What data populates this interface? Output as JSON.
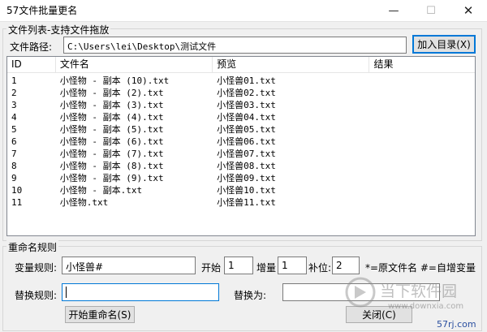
{
  "window": {
    "title": "57文件批量更名",
    "minimize_glyph": "—",
    "maximize_glyph": "☐",
    "close_glyph": "✕"
  },
  "file_list_group": {
    "title": "文件列表-支持文件拖放",
    "path_label": "文件路径:",
    "path_value": "C:\\Users\\lei\\Desktop\\测试文件",
    "add_dir_button": "加入目录(X)"
  },
  "table": {
    "columns": [
      "ID",
      "文件名",
      "预览",
      "结果"
    ],
    "rows": [
      {
        "id": "1",
        "name": "小怪物 - 副本 (10).txt",
        "preview": "小怪兽01.txt",
        "result": ""
      },
      {
        "id": "2",
        "name": "小怪物 - 副本 (2).txt",
        "preview": "小怪兽02.txt",
        "result": ""
      },
      {
        "id": "3",
        "name": "小怪物 - 副本 (3).txt",
        "preview": "小怪兽03.txt",
        "result": ""
      },
      {
        "id": "4",
        "name": "小怪物 - 副本 (4).txt",
        "preview": "小怪兽04.txt",
        "result": ""
      },
      {
        "id": "5",
        "name": "小怪物 - 副本 (5).txt",
        "preview": "小怪兽05.txt",
        "result": ""
      },
      {
        "id": "6",
        "name": "小怪物 - 副本 (6).txt",
        "preview": "小怪兽06.txt",
        "result": ""
      },
      {
        "id": "7",
        "name": "小怪物 - 副本 (7).txt",
        "preview": "小怪兽07.txt",
        "result": ""
      },
      {
        "id": "8",
        "name": "小怪物 - 副本 (8).txt",
        "preview": "小怪兽08.txt",
        "result": ""
      },
      {
        "id": "9",
        "name": "小怪物 - 副本 (9).txt",
        "preview": "小怪兽09.txt",
        "result": ""
      },
      {
        "id": "10",
        "name": "小怪物 - 副本.txt",
        "preview": "小怪兽10.txt",
        "result": ""
      },
      {
        "id": "11",
        "name": "小怪物.txt",
        "preview": "小怪兽11.txt",
        "result": ""
      }
    ]
  },
  "rename_group": {
    "title": "重命名规则",
    "rule_label": "变量规则:",
    "rule_value": "小怪兽#",
    "start_label": "开始",
    "start_value": "1",
    "step_label": "增量",
    "step_value": "1",
    "pad_label": "补位:",
    "pad_value": "2",
    "hint": "*=原文件名 #=自增变量",
    "replace_label": "替换规则:",
    "replace_value": "",
    "replace_with_label": "替换为:",
    "replace_with_value": "",
    "start_rename_button": "开始重命名(S)",
    "close_button": "关闭(C)"
  },
  "watermark": {
    "brand": "当下软件园",
    "url": "www.downxia.com",
    "corner": "57rj.com"
  }
}
